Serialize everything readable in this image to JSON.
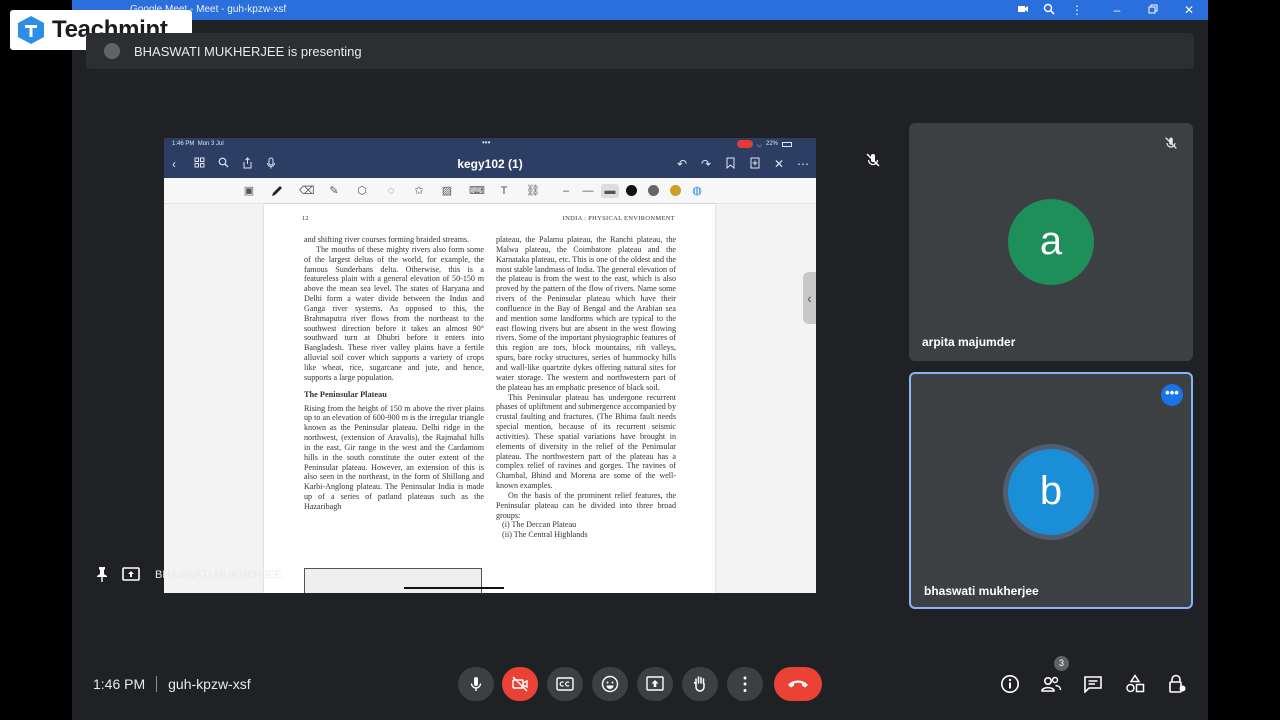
{
  "window": {
    "title": "Google Meet - Meet - guh-kpzw-xsf"
  },
  "watermark": {
    "brand": "Teachmint"
  },
  "presenting_banner": {
    "text": "BHASWATI MUKHERJEE is presenting"
  },
  "shared_screen": {
    "status_time": "1:46 PM",
    "status_date": "Mon 3 Jul",
    "status_dots": "•••",
    "battery": "22%",
    "document_title": "kegy102 (1)",
    "page_number": "12",
    "running_head": "INDIA : PHYSICAL ENVIRONMENT",
    "left_col": {
      "p1": "and shifting river courses forming braided streams.",
      "p2": "The mouths of these mighty rivers also form some of the largest deltas of the world, for example, the famous Sunderbans delta. Otherwise, this is a featureless plain with a general elevation of 50-150 m above the mean sea level. The states of Haryana and Delhi form a water divide between the Indus and Ganga river systems. As opposed to this, the Brahmaputra river flows from the northeast to the southwest direction before it takes an almost 90° southward turn at Dhubri before it enters into Bangladesh. These river valley plains have a fertile alluvial soil cover which supports a variety of crops like wheat, rice, sugarcane and jute, and hence, supports a large population.",
      "heading": "The Peninsular Plateau",
      "p3": "Rising from the height of 150 m above the river plains up to an elevation of 600-900 m is the irregular triangle known as the Peninsular plateau. Delhi ridge in the northwest, (extension of Aravalis), the Rajmahal hills in the east, Gir range in the west and the Cardamom hills in the south constitute the outer extent of the Peninsular plateau. However, an extension of this is also seen in the northeast, in the form of Shillong and Karbi-Anglong plateau. The Peninsular India is made up of a series of patland plateaus such as the Hazaribagh"
    },
    "right_col": {
      "p1": "plateau, the Palamu plateau, the Ranchi plateau, the Malwa plateau, the Coimbatore plateau and the Karnataka plateau, etc. This is one of the oldest and the most stable landmass of India. The general elevation of the plateau is from the west to the east, which is also proved by the pattern of the flow of rivers. Name some rivers of the Peninsular plateau which have their confluence in the Bay of Bengal and the Arabian sea and mention some landforms which are typical to the east flowing rivers but are absent in the west flowing rivers. Some of the important physiographic features of this region are tors, block mountains, rift valleys, spurs, bare rocky structures, series of hummocky hills and wall-like quartzite dykes offering natural sites for water storage. The western and northwestern part of the plateau has an emphatic presence of black soil.",
      "p2": "This Peninsular plateau has undergone recurrent phases of upliftment and submergence accompanied by crustal faulting and fractures. (The Bhima fault needs special mention, because of its recurrent seismic activities). These spatial variations have brought in elements of diversity in the relief of the Peninsular plateau. The northwestern part of the plateau has a complex relief of ravines and gorges. The ravines of Chambal, Bhind and Morena are some of the well-known examples.",
      "p3": "On the basis of the prominent relief features, the Peninsular plateau can be divided into three broad groups:",
      "item1": "(i)  The Deccan Plateau",
      "item2": "(ii)  The Central Highlands"
    },
    "swatch_colors": [
      "#111111",
      "#666666",
      "#c9a227"
    ]
  },
  "presenter_label": "BHASWATI MUKHERJEE",
  "participants": [
    {
      "name": "arpita majumder",
      "initial": "a",
      "color": "#1e8e5a"
    },
    {
      "name": "bhaswati mukherjee",
      "initial": "b",
      "color": "#1a8fd8"
    }
  ],
  "more_options_glyph": "•••",
  "bottom_bar": {
    "time": "1:46 PM",
    "meeting_code": "guh-kpzw-xsf",
    "participant_count": "3"
  },
  "colors": {
    "accent": "#8ab4f8",
    "danger": "#ea4335",
    "surface": "#202124",
    "tile": "#3c4043"
  }
}
